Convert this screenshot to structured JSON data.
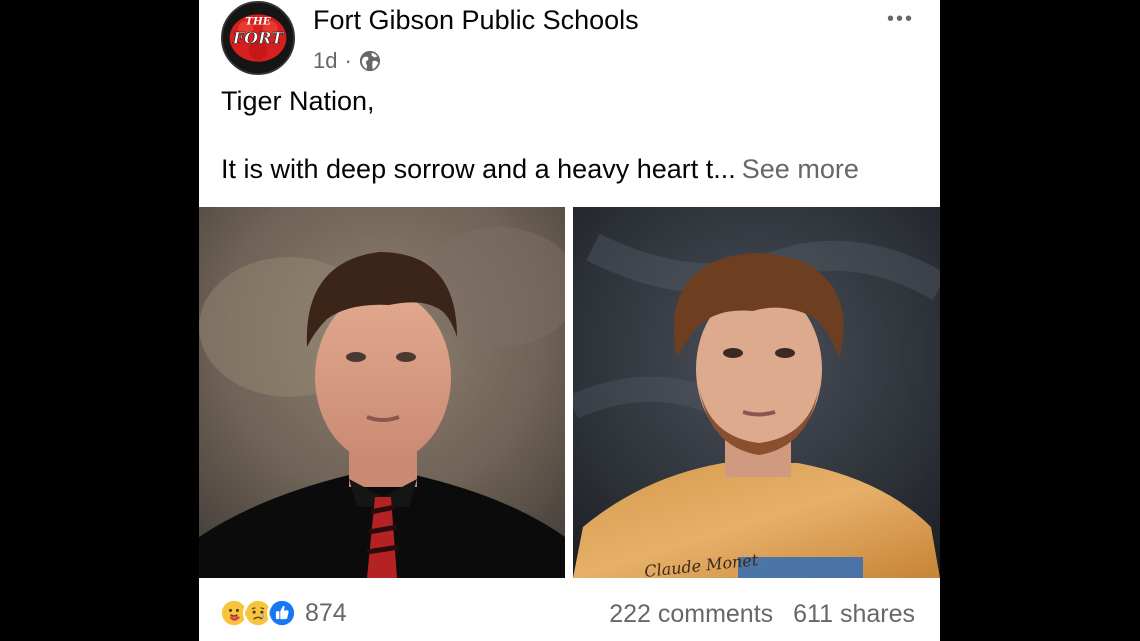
{
  "post": {
    "page_name": "Fort Gibson Public Schools",
    "avatar_text": {
      "top": "THE",
      "main": "FORT"
    },
    "time": "1d",
    "separator": "·",
    "audience_icon": "globe-icon",
    "options_icon": "more-options-icon",
    "options_glyph": "•••",
    "text_line_1": "Tiger Nation,",
    "text_line_2": "It is with deep sorrow and a heavy heart t...",
    "see_more": "See more"
  },
  "photos": {
    "left_icon": "portrait-photo",
    "right_icon": "portrait-photo",
    "right_shirt_text": "Claude Monet"
  },
  "footer": {
    "reaction_icons": [
      "care-reaction-icon",
      "sad-reaction-icon",
      "like-reaction-icon"
    ],
    "reaction_count": "874",
    "comments": "222 comments",
    "shares": "611 shares"
  },
  "colors": {
    "brand_blue": "#1877f2",
    "secondary_text": "#65676b",
    "primary_text": "#050505",
    "logo_red": "#d6201f"
  }
}
